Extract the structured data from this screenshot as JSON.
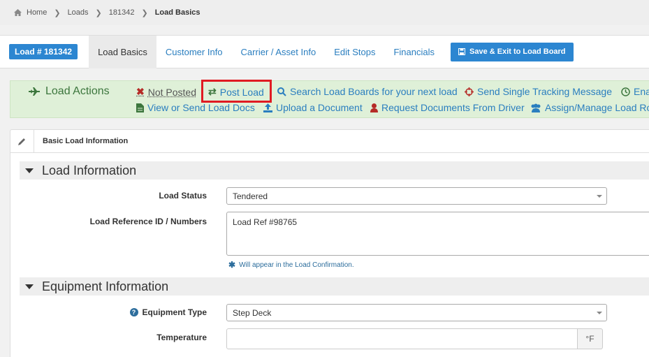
{
  "breadcrumb": {
    "items": [
      "Home",
      "Loads",
      "181342"
    ],
    "current": "Load Basics"
  },
  "tabbar": {
    "load_badge": "Load # 181342",
    "tabs": [
      "Load Basics",
      "Customer Info",
      "Carrier / Asset Info",
      "Edit Stops",
      "Financials"
    ],
    "save_exit_label": "Save & Exit to Load Board"
  },
  "actions": {
    "title": "Load Actions",
    "row1": [
      "Not Posted",
      "Post Load",
      "Search Load Boards for your next load",
      "Send Single Tracking Message",
      "Ena"
    ],
    "row2": [
      "View or Send Load Docs",
      "Upload a Document",
      "Request Documents From Driver",
      "Assign/Manage Load Rol"
    ]
  },
  "panel": {
    "title": "Basic Load Information",
    "load_info": {
      "heading": "Load Information",
      "status_label": "Load Status",
      "status_value": "Tendered",
      "ref_label": "Load Reference ID / Numbers",
      "ref_value": "Load Ref #98765",
      "ref_hint": "Will appear in the Load Confirmation."
    },
    "equipment": {
      "heading": "Equipment Information",
      "type_label": "Equipment Type",
      "type_value": "Step Deck",
      "temp_label": "Temperature",
      "temp_value": "",
      "temp_unit": "°F"
    }
  },
  "colors": {
    "accent": "#2c86d1",
    "actions_bg": "#dff0d8",
    "actions_title": "#3c763d",
    "highlight": "#e01b22"
  }
}
